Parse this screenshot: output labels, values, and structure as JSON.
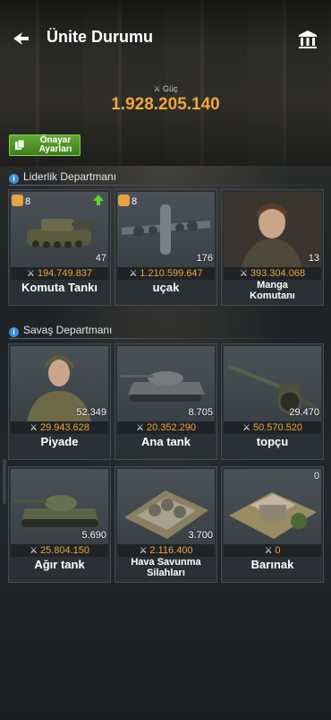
{
  "header": {
    "title": "Ünite Durumu"
  },
  "power": {
    "label": "Güç",
    "value": "1.928.205.140"
  },
  "preset_button": {
    "label_line1": "Önayar",
    "label_line2": "Ayarları"
  },
  "sections": [
    {
      "title": "Liderlik Departmanı",
      "units": [
        {
          "name": "Komuta Tankı",
          "count": "47",
          "power": "194.749.837",
          "badge": "8",
          "upgrade": true
        },
        {
          "name": "uçak",
          "count": "176",
          "power": "1.210.599.647",
          "badge": "8"
        },
        {
          "name_line1": "Manga",
          "name_line2": "Komutanı",
          "count": "13",
          "power": "393.304.068"
        }
      ]
    },
    {
      "title": "Savaş Departmanı",
      "units": [
        {
          "name": "Piyade",
          "count": "52.349",
          "power": "29.943.628"
        },
        {
          "name": "Ana tank",
          "count": "8.705",
          "power": "20.352.290"
        },
        {
          "name": "topçu",
          "count": "29.470",
          "power": "50.570.520"
        },
        {
          "name": "Ağır tank",
          "count": "5.690",
          "power": "25.804.150"
        },
        {
          "name_line1": "Hava Savunma",
          "name_line2": "Silahları",
          "count": "3.700",
          "power": "2.116.400"
        },
        {
          "name": "Barınak",
          "count": "0",
          "power": "0"
        }
      ]
    }
  ],
  "icons": {
    "back": "back-arrow-icon",
    "museum": "museum-icon",
    "power": "crossed-swords-icon",
    "info": "info-icon",
    "preset": "clipboard-icon",
    "upgrade": "up-arrow-icon"
  },
  "colors": {
    "accent": "#f0a63c",
    "green_button": "#4f9129",
    "info": "#3a8fd8"
  }
}
